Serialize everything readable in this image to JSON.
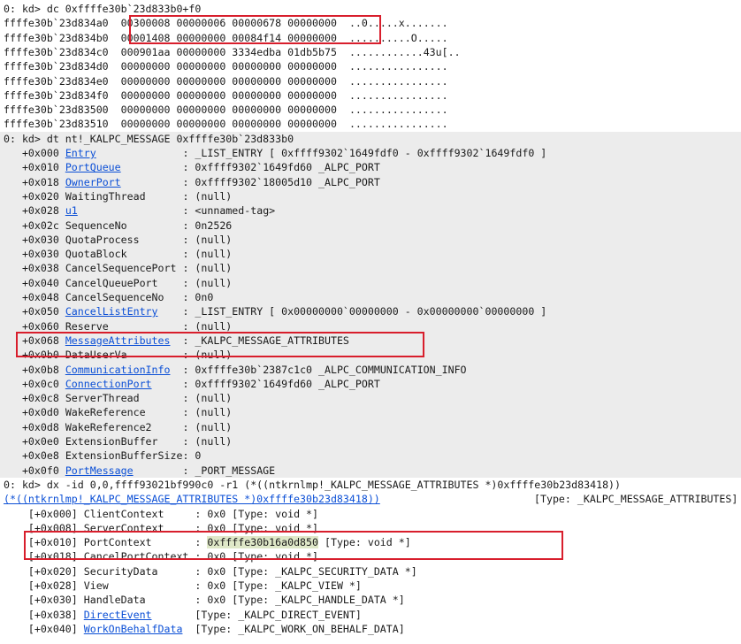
{
  "colors": {
    "link": "#0b4fd6",
    "highlight_box": "#d81e2c",
    "selection": "#dfe8c8",
    "band": "#ececec"
  },
  "dc": {
    "prompt": "0: kd> dc 0xffffe30b`23d833b0+f0",
    "rows": [
      {
        "addr": "ffffe30b`23d834a0",
        "w1": "00300008",
        "w2": "00000006",
        "w3": "00000678",
        "w4": "00000000",
        "ascii": "..0.....x......."
      },
      {
        "addr": "ffffe30b`23d834b0",
        "w1": "00001408",
        "w2": "00000000",
        "w3": "00084f14",
        "w4": "00000000",
        "ascii": "..........O....."
      },
      {
        "addr": "ffffe30b`23d834c0",
        "w1": "000901aa",
        "w2": "00000000",
        "w3": "3334edba",
        "w4": "01db5b75",
        "ascii": "............43u[.."
      },
      {
        "addr": "ffffe30b`23d834d0",
        "w1": "00000000",
        "w2": "00000000",
        "w3": "00000000",
        "w4": "00000000",
        "ascii": "................"
      },
      {
        "addr": "ffffe30b`23d834e0",
        "w1": "00000000",
        "w2": "00000000",
        "w3": "00000000",
        "w4": "00000000",
        "ascii": "................"
      },
      {
        "addr": "ffffe30b`23d834f0",
        "w1": "00000000",
        "w2": "00000000",
        "w3": "00000000",
        "w4": "00000000",
        "ascii": "................"
      },
      {
        "addr": "ffffe30b`23d83500",
        "w1": "00000000",
        "w2": "00000000",
        "w3": "00000000",
        "w4": "00000000",
        "ascii": "................"
      },
      {
        "addr": "ffffe30b`23d83510",
        "w1": "00000000",
        "w2": "00000000",
        "w3": "00000000",
        "w4": "00000000",
        "ascii": "................"
      }
    ]
  },
  "dt": {
    "prompt": "0: kd> dt nt!_KALPC_MESSAGE 0xffffe30b`23d833b0",
    "fields": [
      {
        "off": "+0x000",
        "name": "Entry",
        "link": true,
        "value": ": _LIST_ENTRY [ 0xffff9302`1649fdf0 - 0xffff9302`1649fdf0 ]"
      },
      {
        "off": "+0x010",
        "name": "PortQueue",
        "link": true,
        "value": ": 0xffff9302`1649fd60 _ALPC_PORT"
      },
      {
        "off": "+0x018",
        "name": "OwnerPort",
        "link": true,
        "value": ": 0xffff9302`18005d10 _ALPC_PORT"
      },
      {
        "off": "+0x020",
        "name": "WaitingThread",
        "link": false,
        "value": ": (null)"
      },
      {
        "off": "+0x028",
        "name": "u1",
        "link": true,
        "value": ": <unnamed-tag>"
      },
      {
        "off": "+0x02c",
        "name": "SequenceNo",
        "link": false,
        "value": ": 0n2526"
      },
      {
        "off": "+0x030",
        "name": "QuotaProcess",
        "link": false,
        "value": ": (null)"
      },
      {
        "off": "+0x030",
        "name": "QuotaBlock",
        "link": false,
        "value": ": (null)"
      },
      {
        "off": "+0x038",
        "name": "CancelSequencePort",
        "link": false,
        "value": ": (null)"
      },
      {
        "off": "+0x040",
        "name": "CancelQueuePort",
        "link": false,
        "value": ": (null)"
      },
      {
        "off": "+0x048",
        "name": "CancelSequenceNo",
        "link": false,
        "value": ": 0n0"
      },
      {
        "off": "+0x050",
        "name": "CancelListEntry",
        "link": true,
        "value": ": _LIST_ENTRY [ 0x00000000`00000000 - 0x00000000`00000000 ]"
      },
      {
        "off": "+0x060",
        "name": "Reserve",
        "link": false,
        "value": ": (null)"
      },
      {
        "off": "+0x068",
        "name": "MessageAttributes",
        "link": true,
        "value": ": _KALPC_MESSAGE_ATTRIBUTES"
      },
      {
        "off": "+0x0b0",
        "name": "DataUserVa",
        "link": false,
        "value": ": (null)"
      },
      {
        "off": "+0x0b8",
        "name": "CommunicationInfo",
        "link": true,
        "value": ": 0xffffe30b`2387c1c0 _ALPC_COMMUNICATION_INFO"
      },
      {
        "off": "+0x0c0",
        "name": "ConnectionPort",
        "link": true,
        "value": ": 0xffff9302`1649fd60 _ALPC_PORT"
      },
      {
        "off": "+0x0c8",
        "name": "ServerThread",
        "link": false,
        "value": ": (null)"
      },
      {
        "off": "+0x0d0",
        "name": "WakeReference",
        "link": false,
        "value": ": (null)"
      },
      {
        "off": "+0x0d8",
        "name": "WakeReference2",
        "link": false,
        "value": ": (null)"
      },
      {
        "off": "+0x0e0",
        "name": "ExtensionBuffer",
        "link": false,
        "value": ": (null)"
      },
      {
        "off": "+0x0e8",
        "name": "ExtensionBufferSize",
        "link": false,
        "value": ": 0"
      },
      {
        "off": "+0x0f0",
        "name": "PortMessage",
        "link": true,
        "value": ": _PORT_MESSAGE"
      }
    ]
  },
  "dx": {
    "prompt": "0: kd> dx -id 0,0,ffff93021bf990c0 -r1 (*((ntkrnlmp!_KALPC_MESSAGE_ATTRIBUTES *)0xffffe30b23d83418))",
    "header_link": "(*((ntkrnlmp!_KALPC_MESSAGE_ATTRIBUTES *)0xffffe30b23d83418))",
    "header_type": "[Type: _KALPC_MESSAGE_ATTRIBUTES]",
    "fields": [
      {
        "off": "[+0x000]",
        "name": "ClientContext",
        "link": false,
        "value": ": 0x0",
        "type": "[Type: void *]"
      },
      {
        "off": "[+0x008]",
        "name": "ServerContext",
        "link": false,
        "value": ": 0x0",
        "type": "[Type: void *]"
      },
      {
        "off": "[+0x010]",
        "name": "PortContext",
        "link": false,
        "value": ": 0xffffe30b16a0d850",
        "type": "[Type: void *]",
        "selected": true
      },
      {
        "off": "[+0x018]",
        "name": "CancelPortContext",
        "link": false,
        "value": ": 0x0",
        "type": "[Type: void *]"
      },
      {
        "off": "[+0x020]",
        "name": "SecurityData",
        "link": false,
        "value": ": 0x0",
        "type": "[Type: _KALPC_SECURITY_DATA *]"
      },
      {
        "off": "[+0x028]",
        "name": "View",
        "link": false,
        "value": ": 0x0",
        "type": "[Type: _KALPC_VIEW *]"
      },
      {
        "off": "[+0x030]",
        "name": "HandleData",
        "link": false,
        "value": ": 0x0",
        "type": "[Type: _KALPC_HANDLE_DATA *]"
      },
      {
        "off": "[+0x038]",
        "name": "DirectEvent",
        "link": true,
        "value": "",
        "type": "[Type: _KALPC_DIRECT_EVENT]"
      },
      {
        "off": "[+0x040]",
        "name": "WorkOnBehalfData",
        "link": true,
        "value": "",
        "type": "[Type: _KALPC_WORK_ON_BEHALF_DATA]"
      }
    ]
  }
}
